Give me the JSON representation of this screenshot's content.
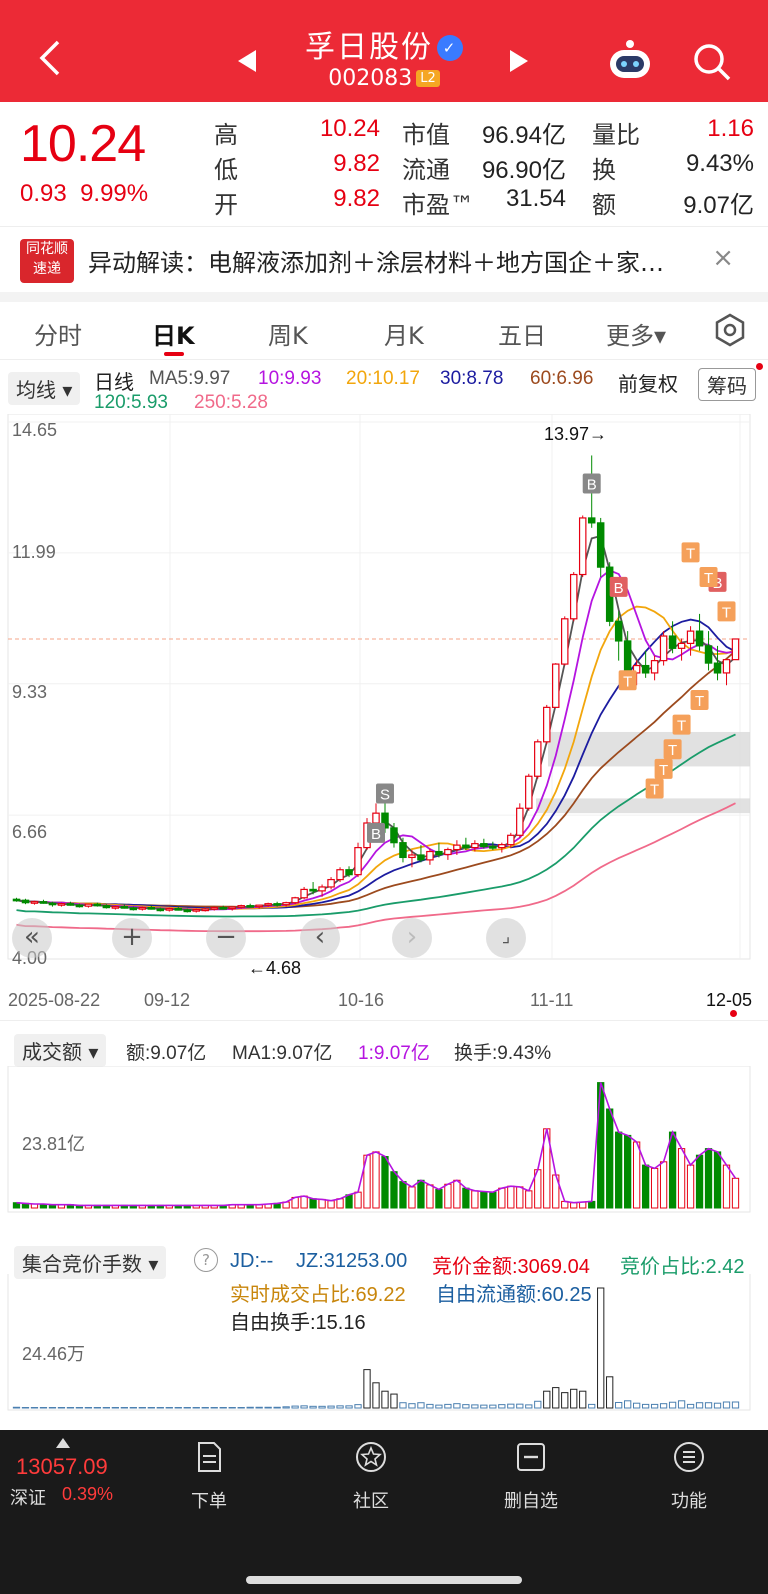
{
  "header": {
    "stock_name": "孚日股份",
    "stock_code": "002083",
    "level_badge": "L2",
    "icons": [
      "back-icon",
      "prev-stock-icon",
      "next-stock-icon",
      "robot-icon",
      "search-icon",
      "verified-icon"
    ]
  },
  "quote": {
    "price": "10.24",
    "change": "0.93",
    "change_pct": "9.99%",
    "high_label": "高",
    "high": "10.24",
    "low_label": "低",
    "low": "9.82",
    "open_label": "开",
    "open": "9.82",
    "mcap_label": "市值",
    "mcap": "96.94亿",
    "float_label": "流通",
    "float": "96.90亿",
    "pe_label": "市盈™",
    "pe": "31.54",
    "vr_label": "量比",
    "vr": "1.16",
    "turnover_label": "换",
    "turnover": "9.43%",
    "amount_label": "额",
    "amount": "9.07亿",
    "colors": {
      "up": "#e60012",
      "down": "#008a00"
    }
  },
  "news": {
    "logo_line1": "同花顺",
    "logo_line2": "速递",
    "text": "异动解读：电解液添加剂＋涂层材料＋地方国企＋家…",
    "close": "×"
  },
  "tabs": [
    "分时",
    "日K",
    "周K",
    "月K",
    "五日",
    "更多▾"
  ],
  "active_tab": "日K",
  "kline": {
    "ma_selector": "均线 ▾",
    "period": "日线",
    "ma5": "MA5:9.97",
    "ma10": "10:9.93",
    "ma20": "20:10.17",
    "ma30": "30:8.78",
    "ma60": "60:6.96",
    "ma120": "120:5.93",
    "ma250": "250:5.28",
    "adjust": "前复权",
    "chip_button": "筹码",
    "max_label": "13.97→",
    "min_label": "←4.68",
    "ma_colors": {
      "ma5": "#555555",
      "ma10": "#b514e0",
      "ma20": "#f2a60c",
      "ma30": "#1c1ca0",
      "ma60": "#9c4a1e",
      "ma120": "#1a9c6a",
      "ma250": "#f06a8a"
    }
  },
  "chart_data": {
    "type": "candlestick",
    "y_ticks": [
      "14.65",
      "11.99",
      "9.33",
      "6.66",
      "4.00"
    ],
    "ylim": [
      4.0,
      14.65
    ],
    "x_ticks": [
      "2025-08-22",
      "09-12",
      "10-16",
      "11-11",
      "12-05"
    ],
    "current_price": 10.24,
    "high": 13.97,
    "low": 4.68,
    "candles": [
      [
        4.95,
        4.98,
        4.9,
        4.93
      ],
      [
        4.93,
        4.96,
        4.85,
        4.88
      ],
      [
        4.88,
        4.92,
        4.84,
        4.9
      ],
      [
        4.9,
        4.94,
        4.86,
        4.87
      ],
      [
        4.87,
        4.9,
        4.8,
        4.84
      ],
      [
        4.84,
        4.88,
        4.8,
        4.86
      ],
      [
        4.86,
        4.9,
        4.82,
        4.83
      ],
      [
        4.83,
        4.86,
        4.78,
        4.81
      ],
      [
        4.81,
        4.86,
        4.78,
        4.85
      ],
      [
        4.85,
        4.88,
        4.8,
        4.82
      ],
      [
        4.82,
        4.85,
        4.76,
        4.78
      ],
      [
        4.78,
        4.82,
        4.74,
        4.8
      ],
      [
        4.8,
        4.84,
        4.76,
        4.77
      ],
      [
        4.77,
        4.8,
        4.72,
        4.76
      ],
      [
        4.76,
        4.8,
        4.72,
        4.78
      ],
      [
        4.78,
        4.82,
        4.74,
        4.75
      ],
      [
        4.75,
        4.78,
        4.7,
        4.74
      ],
      [
        4.74,
        4.78,
        4.7,
        4.76
      ],
      [
        4.76,
        4.8,
        4.72,
        4.73
      ],
      [
        4.73,
        4.76,
        4.68,
        4.72
      ],
      [
        4.72,
        4.76,
        4.68,
        4.74
      ],
      [
        4.74,
        4.78,
        4.7,
        4.75
      ],
      [
        4.75,
        4.8,
        4.72,
        4.78
      ],
      [
        4.78,
        4.82,
        4.74,
        4.76
      ],
      [
        4.76,
        4.8,
        4.72,
        4.79
      ],
      [
        4.79,
        4.84,
        4.76,
        4.82
      ],
      [
        4.82,
        4.86,
        4.78,
        4.8
      ],
      [
        4.8,
        4.84,
        4.76,
        4.83
      ],
      [
        4.83,
        4.88,
        4.8,
        4.86
      ],
      [
        4.86,
        4.9,
        4.8,
        4.84
      ],
      [
        4.84,
        4.9,
        4.8,
        4.88
      ],
      [
        4.88,
        5.0,
        4.85,
        4.98
      ],
      [
        4.98,
        5.2,
        4.95,
        5.15
      ],
      [
        5.15,
        5.3,
        5.05,
        5.12
      ],
      [
        5.12,
        5.25,
        5.0,
        5.2
      ],
      [
        5.2,
        5.4,
        5.15,
        5.35
      ],
      [
        5.35,
        5.6,
        5.3,
        5.55
      ],
      [
        5.55,
        5.62,
        5.4,
        5.45
      ],
      [
        5.45,
        6.1,
        5.4,
        6.0
      ],
      [
        6.0,
        6.6,
        5.95,
        6.5
      ],
      [
        6.5,
        6.9,
        6.4,
        6.7
      ],
      [
        6.7,
        7.1,
        6.3,
        6.4
      ],
      [
        6.4,
        6.5,
        6.0,
        6.1
      ],
      [
        6.1,
        6.2,
        5.7,
        5.8
      ],
      [
        5.8,
        5.95,
        5.6,
        5.85
      ],
      [
        5.85,
        6.05,
        5.7,
        5.75
      ],
      [
        5.75,
        5.98,
        5.65,
        5.92
      ],
      [
        5.92,
        6.1,
        5.8,
        5.86
      ],
      [
        5.86,
        6.0,
        5.75,
        5.96
      ],
      [
        5.96,
        6.15,
        5.85,
        6.05
      ],
      [
        6.05,
        6.2,
        5.95,
        6.0
      ],
      [
        6.0,
        6.15,
        5.92,
        6.08
      ],
      [
        6.08,
        6.18,
        5.98,
        6.02
      ],
      [
        6.02,
        6.12,
        5.95,
        6.0
      ],
      [
        6.0,
        6.1,
        5.9,
        6.06
      ],
      [
        6.06,
        6.3,
        6.0,
        6.25
      ],
      [
        6.25,
        6.9,
        6.2,
        6.8
      ],
      [
        6.8,
        7.5,
        6.75,
        7.45
      ],
      [
        7.45,
        8.2,
        7.4,
        8.15
      ],
      [
        8.15,
        8.9,
        8.1,
        8.85
      ],
      [
        8.85,
        9.75,
        8.85,
        9.73
      ],
      [
        9.73,
        10.7,
        9.7,
        10.65
      ],
      [
        10.65,
        11.6,
        10.6,
        11.55
      ],
      [
        11.55,
        12.75,
        11.5,
        12.7
      ],
      [
        12.7,
        13.97,
        12.5,
        12.6
      ],
      [
        12.6,
        12.7,
        11.5,
        11.7
      ],
      [
        11.7,
        11.8,
        10.5,
        10.6
      ],
      [
        10.6,
        10.8,
        9.8,
        10.2
      ],
      [
        10.2,
        10.4,
        9.4,
        9.55
      ],
      [
        9.55,
        9.8,
        9.3,
        9.7
      ],
      [
        9.7,
        10.0,
        9.45,
        9.55
      ],
      [
        9.55,
        9.9,
        9.4,
        9.8
      ],
      [
        9.8,
        10.4,
        9.7,
        10.3
      ],
      [
        10.3,
        10.6,
        9.95,
        10.05
      ],
      [
        10.05,
        10.25,
        9.8,
        10.15
      ],
      [
        10.15,
        10.5,
        9.9,
        10.4
      ],
      [
        10.4,
        10.75,
        10.0,
        10.1
      ],
      [
        10.1,
        10.4,
        9.6,
        9.75
      ],
      [
        9.75,
        10.1,
        9.4,
        9.55
      ],
      [
        9.55,
        9.82,
        9.3,
        9.82
      ],
      [
        9.82,
        10.24,
        9.82,
        10.24
      ]
    ],
    "markers": [
      {
        "label": "B",
        "type": "buy"
      },
      {
        "label": "S",
        "type": "sell"
      },
      {
        "label": "B",
        "type": "buy"
      },
      {
        "label": "B",
        "type": "buy"
      },
      {
        "label": "T",
        "type": "t"
      }
    ],
    "volume_panel": {
      "selector": "成交额 ▾",
      "amount": "额:9.07亿",
      "ma1": "MA1:9.07亿",
      "ma1_value": "1:9.07亿",
      "turnover": "换手:9.43%",
      "y_tick": "23.81亿",
      "values": [
        0.8,
        0.7,
        0.6,
        0.6,
        0.5,
        0.5,
        0.5,
        0.4,
        0.4,
        0.4,
        0.4,
        0.4,
        0.4,
        0.4,
        0.4,
        0.4,
        0.4,
        0.4,
        0.4,
        0.4,
        0.4,
        0.4,
        0.4,
        0.4,
        0.5,
        0.5,
        0.5,
        0.5,
        0.6,
        0.7,
        0.9,
        1.6,
        1.8,
        1.4,
        1.3,
        1.1,
        1.4,
        2.0,
        2.4,
        8.0,
        8.5,
        7.8,
        5.5,
        4.0,
        3.2,
        4.2,
        3.5,
        2.8,
        3.6,
        4.2,
        3.0,
        2.6,
        2.5,
        2.4,
        3.0,
        3.3,
        3.2,
        2.6,
        5.8,
        12.0,
        5.0,
        1.0,
        0.8,
        0.9,
        1.0,
        19.0,
        15.0,
        11.5,
        11.0,
        10.0,
        6.5,
        6.0,
        7.0,
        11.5,
        9.0,
        6.5,
        8.0,
        9.0,
        8.5,
        6.5,
        4.5
      ]
    },
    "auction_panel": {
      "selector": "集合竞价手数 ▾",
      "jd": "JD:--",
      "jz": "JZ:31253.00",
      "auction_amount": "竞价金额:3069.04",
      "auction_ratio": "竞价占比:2.42",
      "realtime_ratio": "实时成交占比:69.22",
      "free_float": "自由流通额:60.25",
      "free_turnover": "自由换手:15.16",
      "y_tick": "24.46万",
      "values": [
        0.3,
        0.2,
        0.2,
        0.2,
        0.2,
        0.2,
        0.2,
        0.2,
        0.2,
        0.2,
        0.2,
        0.2,
        0.2,
        0.2,
        0.2,
        0.2,
        0.2,
        0.2,
        0.2,
        0.2,
        0.2,
        0.2,
        0.2,
        0.2,
        0.2,
        0.2,
        0.3,
        0.3,
        0.3,
        0.3,
        0.5,
        0.8,
        0.9,
        0.7,
        0.7,
        0.8,
        0.9,
        0.9,
        1.4,
        16.0,
        10.5,
        7.0,
        5.8,
        2.2,
        1.8,
        2.2,
        1.5,
        1.2,
        1.5,
        1.8,
        1.4,
        1.3,
        1.2,
        1.2,
        1.4,
        1.6,
        1.6,
        1.3,
        2.8,
        7.0,
        8.5,
        6.4,
        7.8,
        7.0,
        1.5,
        50.0,
        13.0,
        2.3,
        3.0,
        2.0,
        1.5,
        1.5,
        1.8,
        2.4,
        3.0,
        1.5,
        2.2,
        2.2,
        2.0,
        2.5,
        2.5
      ]
    }
  },
  "bottom_nav": {
    "index_value": "13057.09",
    "index_name": "深证",
    "index_pct": "0.39%",
    "items": [
      "下单",
      "社区",
      "删自选",
      "功能"
    ]
  },
  "chart_controls": [
    "collapse-left-icon",
    "zoom-in-icon",
    "zoom-out-icon",
    "pan-left-icon",
    "pan-right-icon",
    "fullscreen-icon"
  ]
}
